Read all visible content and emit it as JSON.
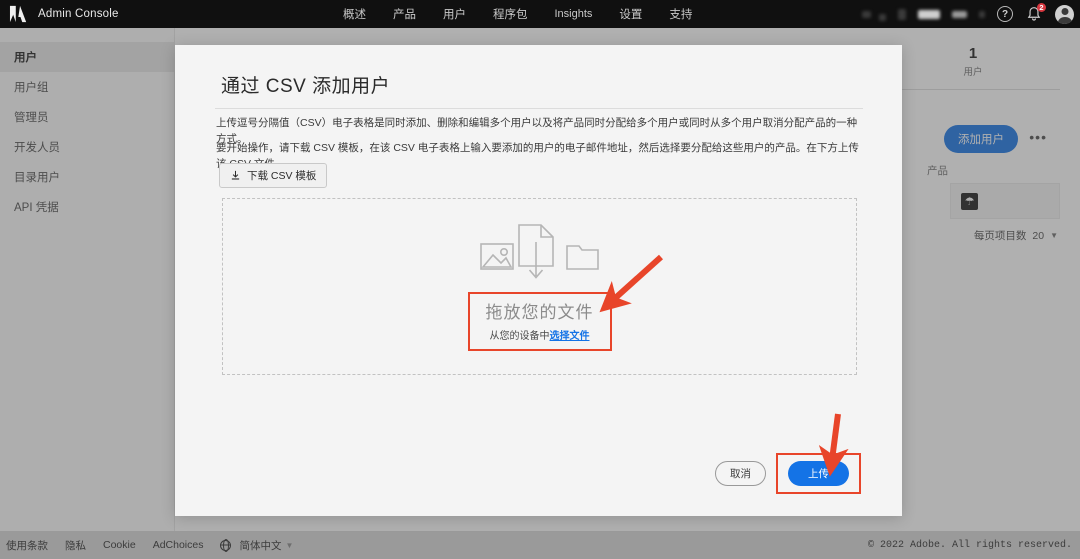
{
  "topbar": {
    "brand_title": "Admin Console",
    "logo_icon": "adobe-logo-icon",
    "nav": [
      {
        "label": "概述"
      },
      {
        "label": "产品"
      },
      {
        "label": "用户"
      },
      {
        "label": "程序包"
      },
      {
        "label": "Insights"
      },
      {
        "label": "设置"
      },
      {
        "label": "支持"
      }
    ],
    "help_icon": "help-icon",
    "help_glyph": "?",
    "bell_icon": "notification-bell-icon",
    "notification_count": "2",
    "avatar_icon": "user-avatar-icon"
  },
  "sidebar": {
    "items": [
      {
        "label": "用户",
        "active": true
      },
      {
        "label": "用户组",
        "active": false
      },
      {
        "label": "管理员",
        "active": false
      },
      {
        "label": "开发人员",
        "active": false
      },
      {
        "label": "目录用户",
        "active": false
      },
      {
        "label": "API 凭据",
        "active": false
      }
    ]
  },
  "background_page": {
    "stat_number": "1",
    "stat_label": "用户",
    "add_user_label": "添加用户",
    "more_menu_glyph": "•••",
    "product_column_header": "产品",
    "product_icon": "acrobat-pdf-icon",
    "per_page_label": "每页项目数",
    "per_page_value": "20",
    "chevron_icon": "chevron-down-icon"
  },
  "modal": {
    "title": "通过 CSV 添加用户",
    "paragraph_1": "上传逗号分隔值（CSV）电子表格是同时添加、删除和编辑多个用户以及将产品同时分配给多个用户或同时从多个用户取消分配产品的一种方式。",
    "paragraph_2": "要开始操作，请下载 CSV 模板，在该 CSV 电子表格上输入要添加的用户的电子邮件地址，然后选择要分配给这些用户的产品。在下方上传该 CSV 文件。",
    "download_button_label": "下载 CSV 模板",
    "download_icon": "download-icon",
    "dropzone": {
      "illustration_icon": "image-document-folder-upload-icon",
      "title": "拖放您的文件",
      "subtitle_prefix": "从您的设备中",
      "subtitle_link": "选择文件"
    },
    "cancel_label": "取消",
    "upload_label": "上传"
  },
  "annotations": {
    "accent_color": "#e8452a",
    "arrow_1_target": "拖放您的文件",
    "arrow_2_target": "上传"
  },
  "footer": {
    "links": [
      {
        "label": "使用条款"
      },
      {
        "label": "隐私"
      },
      {
        "label": "Cookie"
      },
      {
        "label": "AdChoices"
      }
    ],
    "globe_icon": "globe-icon",
    "language": "简体中文",
    "language_chevron_icon": "chevron-down-icon",
    "copyright": "© 2022 Adobe. All rights reserved."
  }
}
